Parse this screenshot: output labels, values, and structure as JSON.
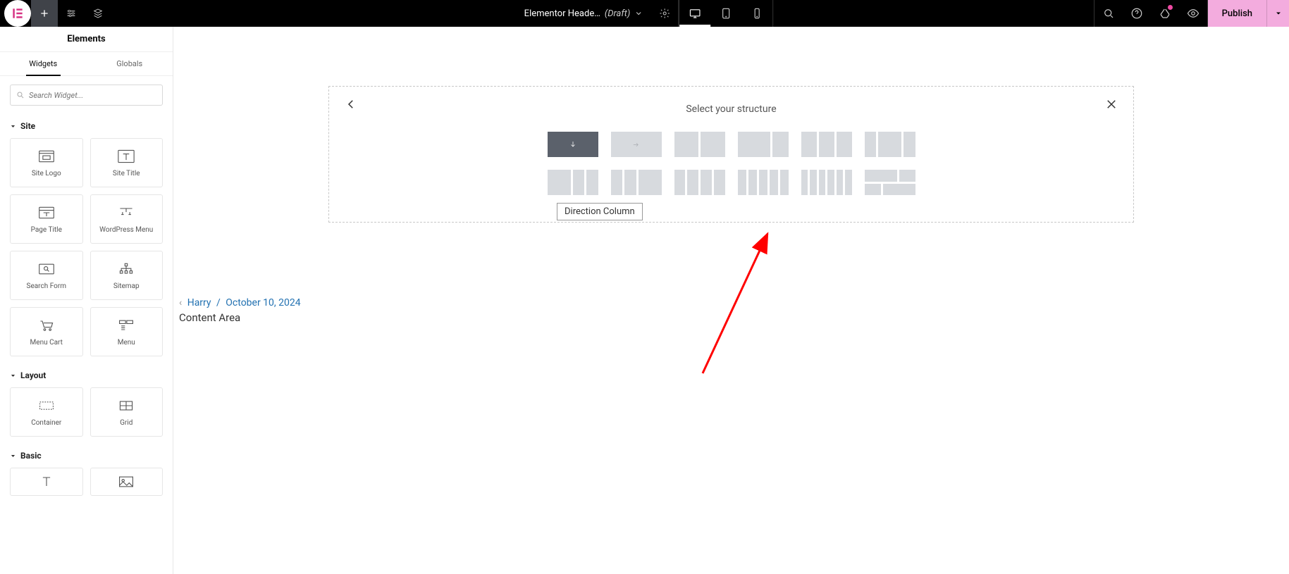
{
  "topbar": {
    "title": "Elementor Heade…",
    "draft": "(Draft)",
    "publish": "Publish"
  },
  "sidebar": {
    "header": "Elements",
    "tabs": {
      "widgets": "Widgets",
      "globals": "Globals"
    },
    "search_placeholder": "Search Widget...",
    "sections": {
      "site": "Site",
      "layout": "Layout",
      "basic": "Basic"
    },
    "widgets": {
      "site_logo": "Site Logo",
      "site_title": "Site Title",
      "page_title": "Page Title",
      "wordpress_menu": "WordPress Menu",
      "search_form": "Search Form",
      "sitemap": "Sitemap",
      "menu_cart": "Menu Cart",
      "menu": "Menu",
      "container": "Container",
      "grid": "Grid"
    }
  },
  "canvas": {
    "author_prefix": "Harry",
    "date": "October 10, 2024",
    "content_area": "Content Area",
    "structure_title": "Select your structure",
    "tooltip": "Direction Column"
  }
}
